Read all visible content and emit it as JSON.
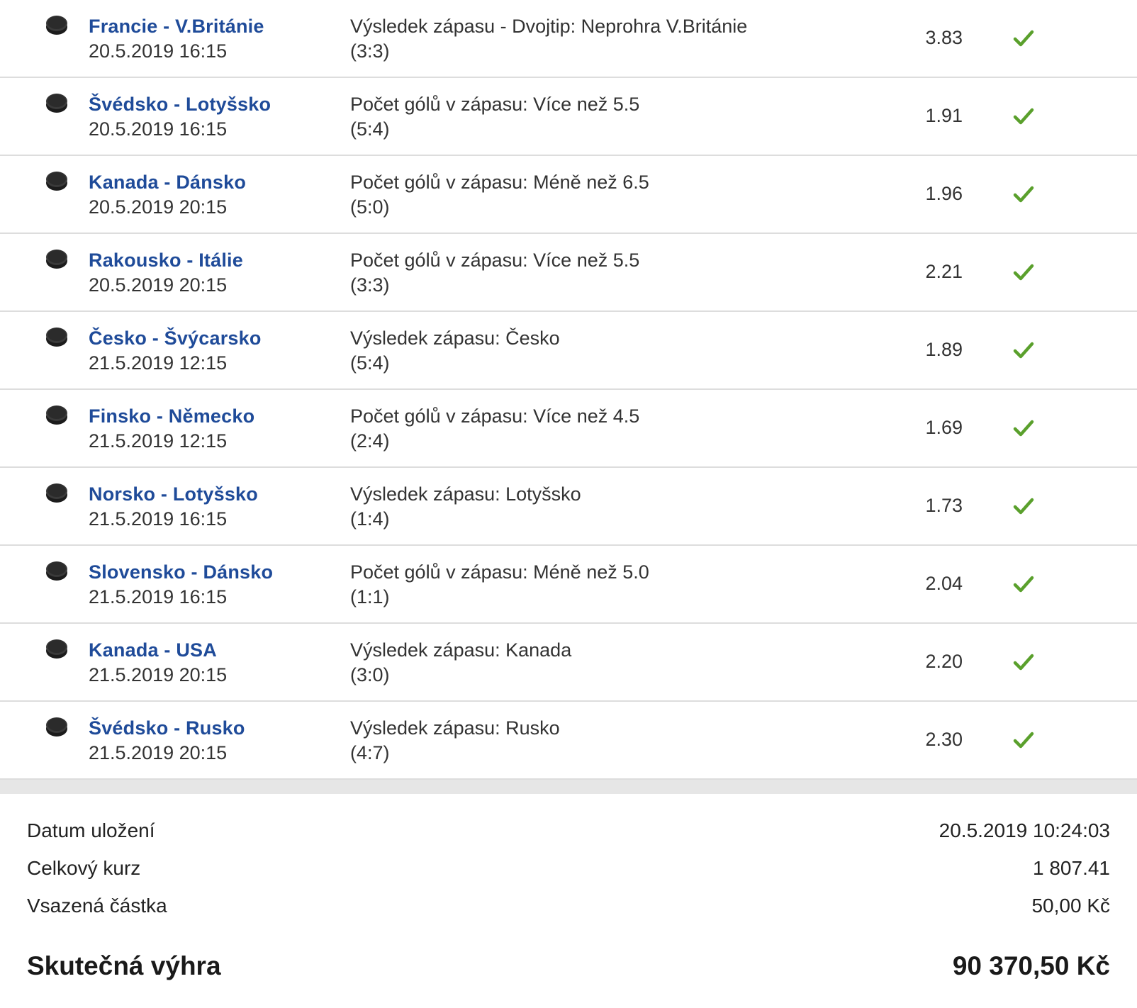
{
  "bets": [
    {
      "match": "Francie - V.Británie",
      "date": "20.5.2019 16:15",
      "bet": "Výsledek zápasu - Dvojtip: Neprohra V.Británie",
      "result": "(3:3)",
      "odds": "3.83"
    },
    {
      "match": "Švédsko - Lotyšsko",
      "date": "20.5.2019 16:15",
      "bet": "Počet gólů v zápasu: Více než 5.5",
      "result": "(5:4)",
      "odds": "1.91"
    },
    {
      "match": "Kanada - Dánsko",
      "date": "20.5.2019 20:15",
      "bet": "Počet gólů v zápasu: Méně než 6.5",
      "result": "(5:0)",
      "odds": "1.96"
    },
    {
      "match": "Rakousko - Itálie",
      "date": "20.5.2019 20:15",
      "bet": "Počet gólů v zápasu: Více než 5.5",
      "result": "(3:3)",
      "odds": "2.21"
    },
    {
      "match": "Česko - Švýcarsko",
      "date": "21.5.2019 12:15",
      "bet": "Výsledek zápasu: Česko",
      "result": "(5:4)",
      "odds": "1.89"
    },
    {
      "match": "Finsko - Německo",
      "date": "21.5.2019 12:15",
      "bet": "Počet gólů v zápasu: Více než 4.5",
      "result": "(2:4)",
      "odds": "1.69"
    },
    {
      "match": "Norsko - Lotyšsko",
      "date": "21.5.2019 16:15",
      "bet": "Výsledek zápasu: Lotyšsko",
      "result": "(1:4)",
      "odds": "1.73"
    },
    {
      "match": "Slovensko - Dánsko",
      "date": "21.5.2019 16:15",
      "bet": "Počet gólů v zápasu: Méně než 5.0",
      "result": "(1:1)",
      "odds": "2.04"
    },
    {
      "match": "Kanada - USA",
      "date": "21.5.2019 20:15",
      "bet": "Výsledek zápasu: Kanada",
      "result": "(3:0)",
      "odds": "2.20"
    },
    {
      "match": "Švédsko - Rusko",
      "date": "21.5.2019 20:15",
      "bet": "Výsledek zápasu: Rusko",
      "result": "(4:7)",
      "odds": "2.30"
    }
  ],
  "icons": {
    "sport": "hockey-puck-icon",
    "status": "checkmark-icon"
  },
  "colors": {
    "match_link": "#1f4b99",
    "won_check": "#5aa02c"
  },
  "summary": {
    "saved_date_label": "Datum uložení",
    "saved_date_value": "20.5.2019 10:24:03",
    "total_odds_label": "Celkový kurz",
    "total_odds_value": "1 807.41",
    "stake_label": "Vsazená částka",
    "stake_value": "50,00 Kč",
    "actual_win_label": "Skutečná výhra",
    "actual_win_value": "90 370,50 Kč"
  }
}
